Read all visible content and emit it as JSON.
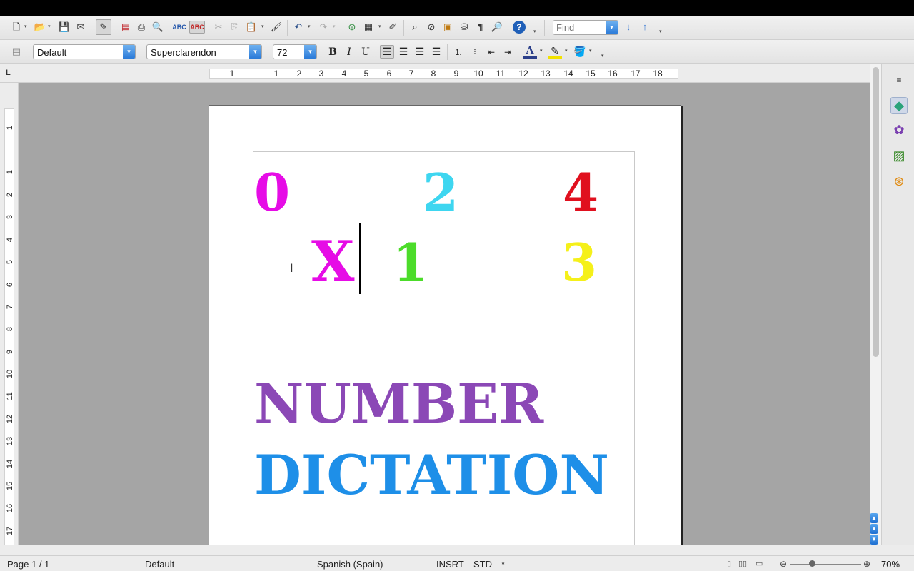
{
  "toolbar1": {
    "icons": [
      "new-document-icon",
      "open-folder-icon",
      "save-icon",
      "email-icon",
      "edit-mode-icon",
      "export-pdf-icon",
      "print-icon",
      "print-preview-icon",
      "spellcheck-icon",
      "autospell-icon",
      "cut-icon",
      "copy-icon",
      "paste-icon",
      "clone-format-icon",
      "undo-icon",
      "redo-icon",
      "hyperlink-icon",
      "table-icon",
      "draw-functions-icon",
      "find-replace-icon",
      "navigator-icon",
      "gallery-icon",
      "data-sources-icon",
      "formatting-marks-icon",
      "zoom-icon",
      "help-icon"
    ],
    "find_placeholder": "Find",
    "find_next": "↓",
    "find_prev": "↑"
  },
  "toolbar2": {
    "paragraph_style": "Default",
    "font_name": "Superclarendon",
    "font_size": "72",
    "bold": "B",
    "italic": "I",
    "underline": "U",
    "align_left_active": true
  },
  "ruler": {
    "h_numbers": [
      "1",
      "1",
      "2",
      "3",
      "4",
      "5",
      "6",
      "7",
      "8",
      "9",
      "10",
      "11",
      "12",
      "13",
      "14",
      "15",
      "16",
      "17",
      "18"
    ],
    "v_numbers": [
      "1",
      "1",
      "2",
      "3",
      "4",
      "5",
      "6",
      "7",
      "8",
      "9",
      "10",
      "11",
      "12",
      "13",
      "14",
      "15",
      "16",
      "17"
    ],
    "corner": "L"
  },
  "document": {
    "digits_row1": [
      {
        "text": "0",
        "color": "#e60ce6"
      },
      {
        "text": "2",
        "color": "#3ed6f0"
      },
      {
        "text": "4",
        "color": "#e0101e"
      }
    ],
    "row2_x": {
      "text": "X",
      "color": "#e60ce6"
    },
    "digits_row2": [
      {
        "text": "1",
        "color": "#4cdc2a"
      },
      {
        "text": "3",
        "color": "#f5f01a"
      }
    ],
    "title_line1": {
      "text": "NUMBER",
      "color": "#8b48b6"
    },
    "title_line2": {
      "text": "DICTATION",
      "color": "#1e8fe8"
    }
  },
  "sidebar": {
    "icons": [
      "sidebar-menu-icon",
      "properties-icon",
      "styles-icon",
      "gallery-icon",
      "navigator-icon"
    ]
  },
  "status": {
    "page": "Page 1 / 1",
    "style": "Default",
    "language": "Spanish (Spain)",
    "insert_mode": "INSRT",
    "selection_mode": "STD",
    "modified": "*",
    "zoom": "70%",
    "zoom_out": "⊖",
    "zoom_in": "⊕"
  }
}
